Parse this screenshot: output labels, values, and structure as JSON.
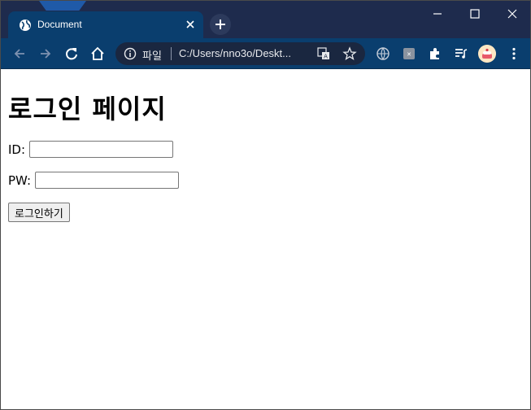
{
  "browser": {
    "tab": {
      "title": "Document",
      "favicon": "globe-icon",
      "close": "close-icon"
    },
    "new_tab": "plus-icon",
    "window_controls": [
      "minimize-icon",
      "maximize-icon",
      "close-icon"
    ],
    "toolbar": {
      "back": "back-arrow-icon",
      "forward": "forward-arrow-icon",
      "reload": "reload-icon",
      "home": "home-icon",
      "omnibox": {
        "info_icon": "info-icon",
        "scheme_label": "파일",
        "url": "C:/Users/nno3o/Deskt...",
        "translate_icon": "translate-icon",
        "bookmark_icon": "star-icon"
      },
      "extensions": [
        "globe-extension-icon",
        "grid-extension-icon",
        "puzzle-icon",
        "media-queue-icon"
      ],
      "profile": "avatar",
      "menu": "kebab-menu-icon"
    }
  },
  "page": {
    "heading": "로그인 페이지",
    "id_label": "ID:",
    "pw_label": "PW:",
    "id_value": "",
    "pw_value": "",
    "submit_label": "로그인하기"
  },
  "colors": {
    "tabstrip": "#1e2b4d",
    "toolbar": "#0a3e6e",
    "omnibox": "#1a2740"
  }
}
